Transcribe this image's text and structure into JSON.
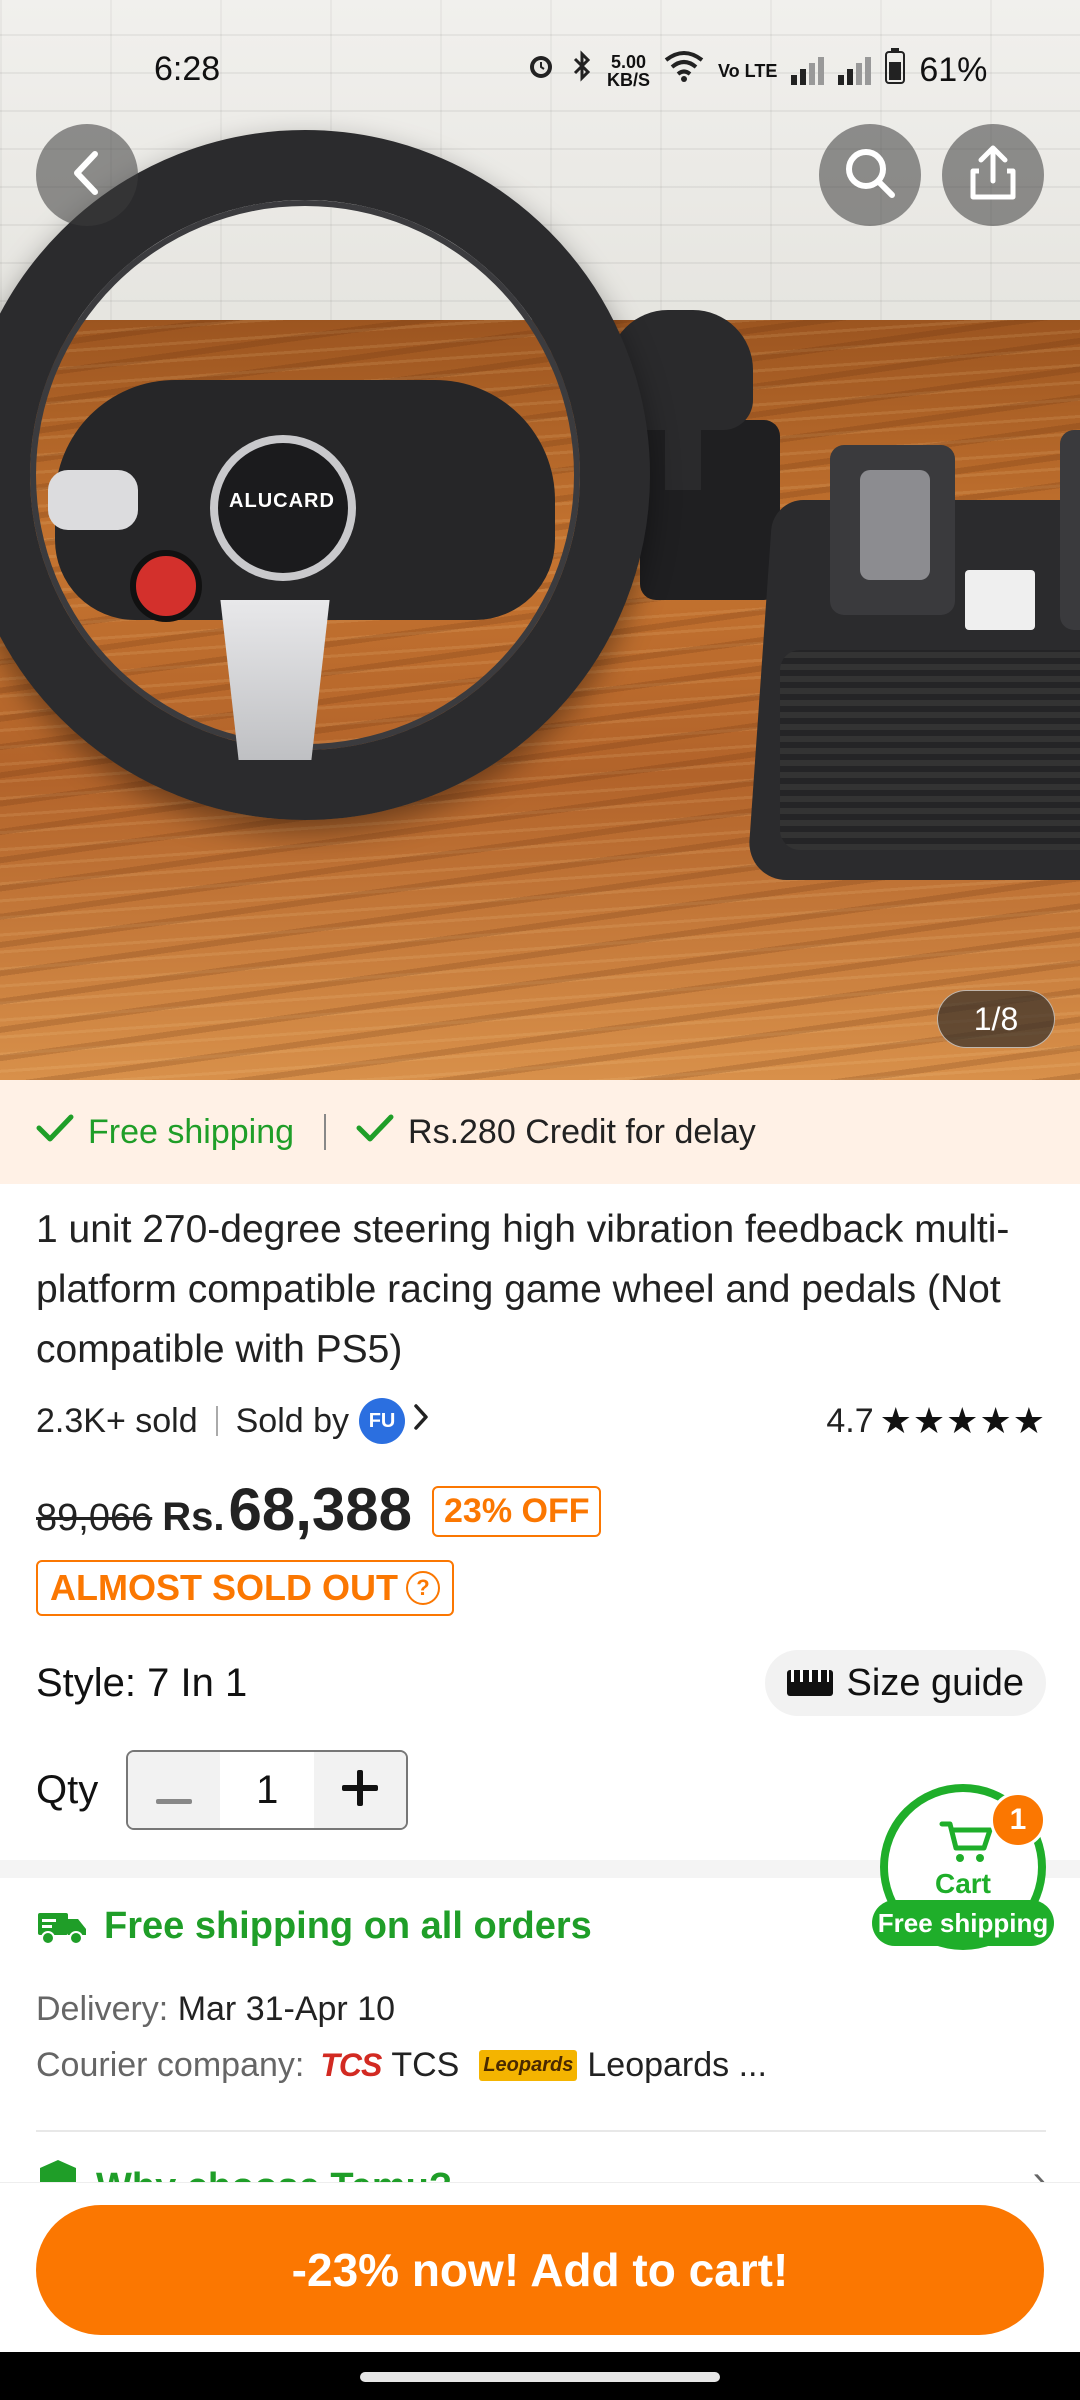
{
  "status_bar": {
    "time": "6:28",
    "net_speed_value": "5.00",
    "net_speed_unit": "KB/S",
    "network_label": "Vo LTE",
    "battery": "61%"
  },
  "hero": {
    "image_counter": "1/8",
    "wheel_logo_text": "ALUCARD"
  },
  "shipping_banner": {
    "free_shipping": "Free shipping",
    "credit_delay": "Rs.280 Credit for delay"
  },
  "product": {
    "title": "1 unit 270-degree steering high vibration feedback multi-platform compatible racing game wheel and pedals (Not compatible with PS5)",
    "sold_count": "2.3K+ sold",
    "sold_by_label": "Sold by",
    "seller_initials": "FU",
    "rating": "4.7",
    "stars": "★★★★★",
    "original_price": "89,066",
    "currency": "Rs.",
    "price": "68,388",
    "discount": "23% OFF",
    "stock_status": "ALMOST SOLD OUT",
    "style_label": "Style: 7 In 1",
    "size_guide": "Size guide",
    "qty_label": "Qty",
    "qty_value": "1"
  },
  "shipping_info": {
    "free_all_orders": "Free shipping on all orders",
    "delivery_label": "Delivery:",
    "delivery_value": "Mar 31-Apr 10",
    "courier_label": "Courier company:",
    "tcs_logo": "TCS",
    "courier1": "TCS",
    "leopards_logo": "Leopards",
    "courier2": "Leopards ...",
    "why_choose": "Why choose Temu?"
  },
  "cart_float": {
    "badge_count": "1",
    "label": "Cart",
    "free_shipping": "Free shipping"
  },
  "cta": {
    "add_to_cart": "-23% now! Add to cart!"
  },
  "colors": {
    "accent_orange": "#fb7701",
    "success_green": "#1f9e28",
    "banner_bg": "#fff1e6"
  }
}
